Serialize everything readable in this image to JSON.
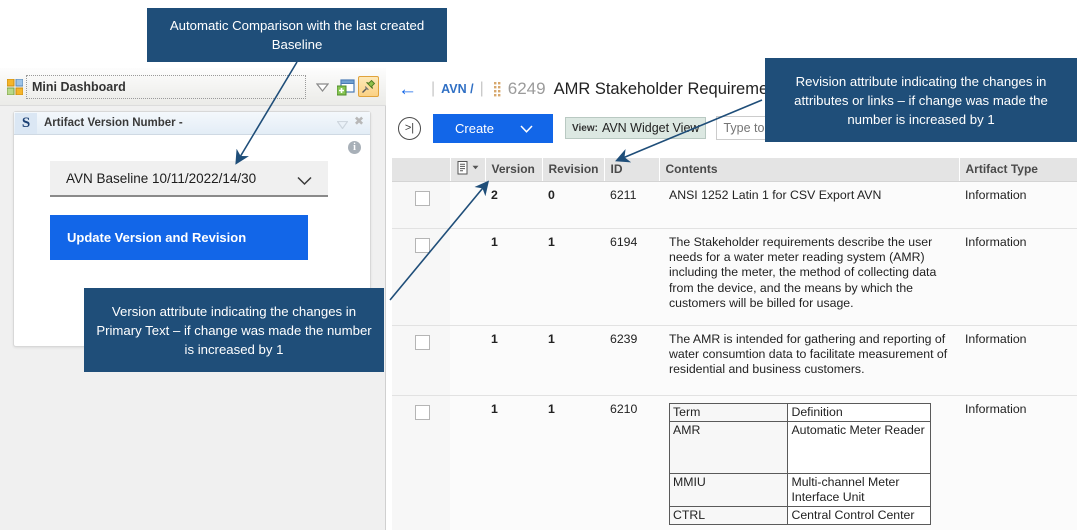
{
  "left_panel": {
    "grid_icon": "grid-icon",
    "title": "Mini Dashboard",
    "tools": {
      "caret": "chevron-down-icon",
      "window": "add-widget-icon",
      "pin": "pin-icon"
    },
    "widget": {
      "brand_letter": "S",
      "title": "Artifact Version Number -",
      "collapse_icon": "chevron-down-icon",
      "close_icon": "close-icon",
      "info_icon": "i",
      "baseline_select": {
        "value": "AVN Baseline 10/11/2022/14/30",
        "caret": "chevron-down-icon"
      },
      "update_button": "Update Version and Revision"
    }
  },
  "right_panel": {
    "breadcrumb": {
      "back_icon": "arrow-left-icon",
      "project": "AVN /",
      "drag_handle": "drag-handle-icon",
      "artifact_id": "6249",
      "artifact_title": "AMR Stakeholder Requirements"
    },
    "toolbar": {
      "expand_icon": ">|",
      "create_label": "Create",
      "create_caret": "chevron-down-icon",
      "view_key": "View:",
      "view_value": "AVN Widget View",
      "filter_placeholder": "Type to filter"
    },
    "table": {
      "columns": [
        "",
        "",
        "Version",
        "Revision",
        "ID",
        "Contents",
        "Artifact Type"
      ],
      "column_icon": "document-menu-icon",
      "rows": [
        {
          "checkbox": "row-checkbox",
          "version": "2",
          "revision": "0",
          "id": "6211",
          "contents": "ANSI 1252 Latin 1 for CSV Export AVN",
          "artifact_type": "Information"
        },
        {
          "checkbox": "row-checkbox",
          "version": "1",
          "revision": "1",
          "id": "6194",
          "contents": "The Stakeholder requirements describe the user needs for a water meter reading system (AMR) including the meter, the method of collecting data from the device, and the means by which the customers will be billed for usage.",
          "artifact_type": "Information"
        },
        {
          "checkbox": "row-checkbox",
          "version": "1",
          "revision": "1",
          "id": "6239",
          "contents": "The AMR is intended for gathering and reporting of water consumtion data to facilitate measurement of residential and business customers.",
          "artifact_type": "Information"
        },
        {
          "checkbox": "row-checkbox",
          "version": "1",
          "revision": "1",
          "id": "6210",
          "contents": "",
          "artifact_type": "Information",
          "term_table": {
            "headers": [
              "Term",
              "Definition"
            ],
            "rows": [
              {
                "term": "AMR",
                "definition": "Automatic Meter Reader",
                "definition_is_link": true
              },
              {
                "term": "MMIU",
                "definition": "Multi-channel Meter Interface Unit",
                "definition_is_link": false
              },
              {
                "term": "CTRL",
                "definition": "Central Control Center",
                "definition_is_link": false
              }
            ]
          }
        }
      ]
    }
  },
  "callouts": {
    "top": "Automatic Comparison with the last created Baseline",
    "revision": "Revision attribute indicating the changes in attributes or links – if change was made the number is increased by 1",
    "version": "Version attribute indicating the changes in Primary Text – if change was made the number is increased by 1"
  },
  "colors": {
    "callout_bg": "#1f4e79",
    "primary_blue": "#1266e8",
    "link_blue": "#2f6fc4",
    "header_gray": "#e4e4e4",
    "pin_orange": "#fbd184"
  }
}
